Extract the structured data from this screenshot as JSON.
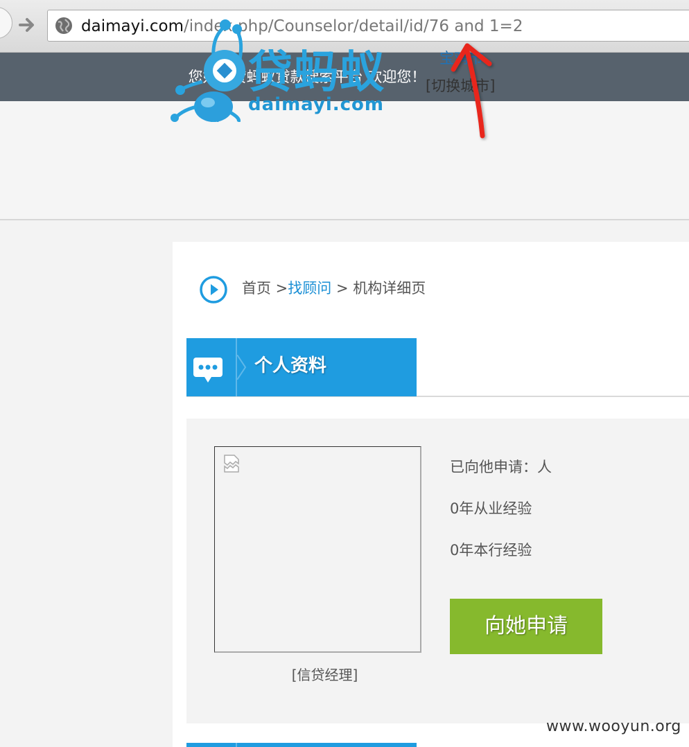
{
  "browser": {
    "url_domain": "daimayi.com",
    "url_path": "/index.php/Counselor/detail/id/76 and 1=2"
  },
  "welcome": {
    "text": "您好，贷蚂蚁贷款搜索平台 欢迎您！"
  },
  "header": {
    "logo_text": "贷蚂蚁",
    "logo_domain": "daimayi.com",
    "city": "宝鸡市",
    "switch_city": "[切换城市]"
  },
  "breadcrumb": {
    "home": "首页 >",
    "link": "找顾问",
    "separator": " > ",
    "current": "机构详细页"
  },
  "section": {
    "title": "个人资料"
  },
  "profile": {
    "caption": "[信贷经理]",
    "applied": "已向他申请：人",
    "industry_years": "0年从业经验",
    "company_years": "0年本行经验",
    "apply_button": "向她申请"
  },
  "watermark": "www.wooyun.org",
  "colors": {
    "primary_blue": "#1f9ce0",
    "apply_green": "#86b92d",
    "welcome_bar": "#57626d",
    "annotation_red": "#e8281e"
  }
}
